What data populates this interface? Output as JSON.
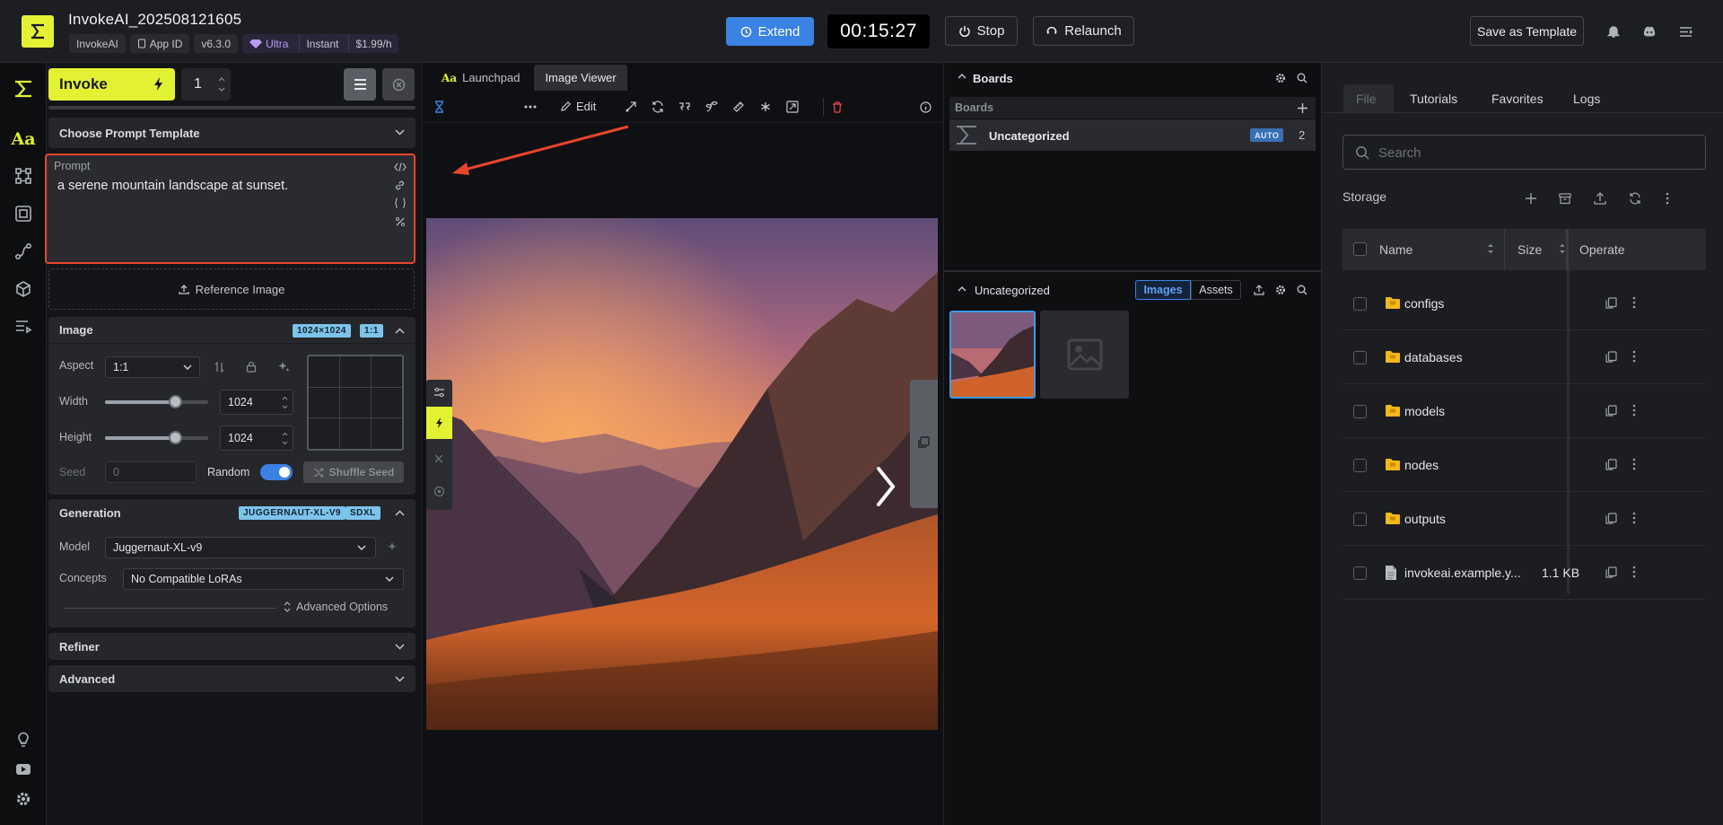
{
  "topbar": {
    "title": "InvokeAI_202508121605",
    "chips": {
      "app": "InvokeAI",
      "app_id": "App ID",
      "version": "v6.3.0",
      "plan": "Ultra",
      "mode": "Instant",
      "price": "$1.99/h"
    },
    "extend_label": "Extend",
    "timer": "00:15:27",
    "stop_label": "Stop",
    "relaunch_label": "Relaunch",
    "save_template_label": "Save as Template"
  },
  "left": {
    "invoke_label": "Invoke",
    "quantity": "1",
    "prompt_template_label": "Choose Prompt Template",
    "prompt_label": "Prompt",
    "prompt_text": "a serene mountain landscape at sunset.",
    "reference_image_label": "Reference Image",
    "image_section": {
      "title": "Image",
      "size_tag": "1024×1024",
      "ratio_tag": "1:1",
      "aspect_label": "Aspect",
      "aspect_value": "1:1",
      "width_label": "Width",
      "width_value": "1024",
      "width_fraction": 0.68,
      "height_label": "Height",
      "height_value": "1024",
      "height_fraction": 0.68,
      "seed_label": "Seed",
      "seed_value": "0",
      "random_label": "Random",
      "shuffle_label": "Shuffle Seed"
    },
    "generation": {
      "title": "Generation",
      "model_tag": "JUGGERNAUT-XL-V9",
      "base_tag": "SDXL",
      "model_label": "Model",
      "model_value": "Juggernaut-XL-v9",
      "concepts_label": "Concepts",
      "concepts_value": "No Compatible LoRAs",
      "advanced_options_label": "Advanced Options"
    },
    "refiner_label": "Refiner",
    "advanced_label": "Advanced"
  },
  "center": {
    "tabs": [
      {
        "label": "Launchpad"
      },
      {
        "label": "Image Viewer"
      }
    ],
    "edit_label": "Edit"
  },
  "gallery": {
    "boards_title": "Boards",
    "boards_header": "Boards",
    "board_name": "Uncategorized",
    "auto_tag": "AUTO",
    "board_count": "2",
    "section_title": "Uncategorized",
    "images_tab": "Images",
    "assets_tab": "Assets"
  },
  "files": {
    "tabs": [
      {
        "label": "File"
      },
      {
        "label": "Tutorials"
      },
      {
        "label": "Favorites"
      },
      {
        "label": "Logs"
      }
    ],
    "search_placeholder": "Search",
    "storage_label": "Storage",
    "col_name": "Name",
    "col_size": "Size",
    "col_operate": "Operate",
    "rows": [
      {
        "name": "configs",
        "size": ""
      },
      {
        "name": "databases",
        "size": ""
      },
      {
        "name": "models",
        "size": ""
      },
      {
        "name": "nodes",
        "size": ""
      },
      {
        "name": "outputs",
        "size": ""
      },
      {
        "name": "invokeai.example.y...",
        "size": "1.1 KB"
      }
    ]
  },
  "colors": {
    "accent": "#e2f233",
    "highlight": "#e8452c",
    "primary": "#3a82e4"
  }
}
